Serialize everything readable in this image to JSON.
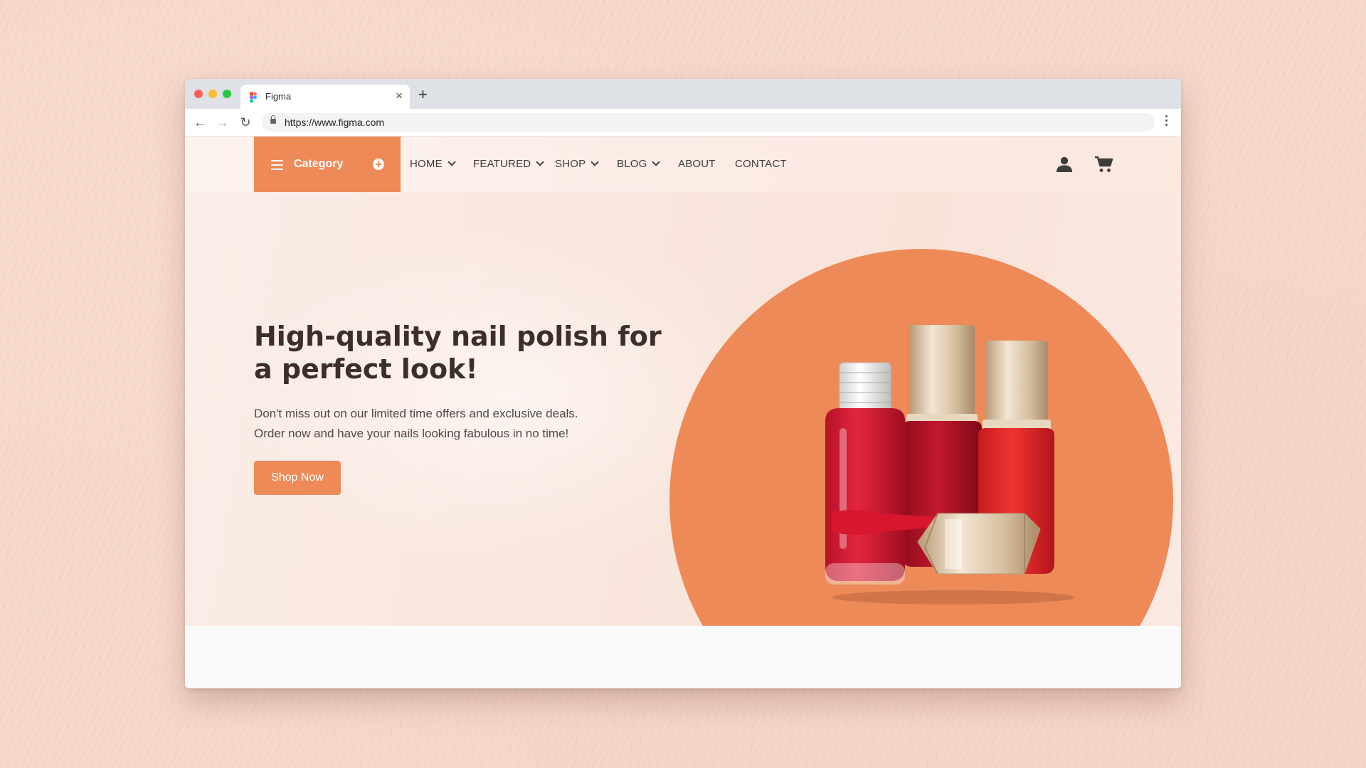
{
  "browser": {
    "tab_title": "Figma",
    "url": "https://www.figma.com",
    "new_tab_glyph": "+",
    "close_glyph": "×",
    "back_glyph": "←",
    "forward_glyph": "→",
    "reload_glyph": "↻"
  },
  "header": {
    "category_label": "Category",
    "nav": [
      {
        "label": "HOME",
        "dropdown": true
      },
      {
        "label": "FEATURED",
        "dropdown": true
      },
      {
        "label": "SHOP",
        "dropdown": true
      },
      {
        "label": "BLOG",
        "dropdown": true
      },
      {
        "label": "ABOUT",
        "dropdown": false
      },
      {
        "label": "CONTACT",
        "dropdown": false
      }
    ],
    "icons": [
      "user-icon",
      "cart-icon"
    ]
  },
  "hero": {
    "title": "High-quality nail polish for a perfect look!",
    "subtitle_line1": "Don't miss out on our limited time offers and exclusive deals.",
    "subtitle_line2": "Order now and have your nails looking fabulous in no time!",
    "cta_label": "Shop Now"
  },
  "colors": {
    "accent": "#ee8a58",
    "text_dark": "#3a2f2b",
    "polish_red": "#d8162e"
  }
}
